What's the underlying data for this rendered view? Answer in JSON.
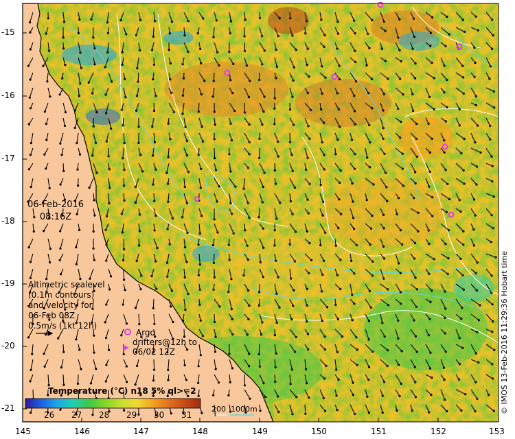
{
  "map": {
    "date": "06-Feb-2016",
    "time": "08:16Z",
    "credit": "© IMOS 13-Feb-2016 11:29:36 Hobart time",
    "y_ticks": [
      "-15",
      "-16",
      "-17",
      "-18",
      "-19",
      "-20",
      "-21"
    ],
    "x_ticks": [
      "145",
      "146",
      "147",
      "148",
      "149",
      "150",
      "151",
      "152",
      "153"
    ],
    "altimetry_legend": {
      "line1": "Altimetric sealevel",
      "line2": "(0.1m contours)",
      "line3": "and velocity for",
      "line4": "06-Feb 08Z",
      "line5": "0.5m/s (1kt 12h)"
    },
    "argo_legend": {
      "line1": "Argo",
      "line2": "drifters@12h to",
      "line3": "06/02 12Z"
    },
    "colorbar": {
      "title": "Temperature (°C) n18 5% ql>=2",
      "ticks": [
        "26",
        "27",
        "28",
        "29",
        "30",
        "31"
      ],
      "colors": [
        "#2b1b9a",
        "#1f5fe0",
        "#1ea6e6",
        "#20d0b4",
        "#3ec84a",
        "#7ed628",
        "#c8e030",
        "#f2d830",
        "#f2a020",
        "#e07020",
        "#c84a18",
        "#a02a10"
      ]
    },
    "depth_legend": {
      "label1": "200",
      "label2": "1000m"
    },
    "colors": {
      "land": "#f8c89c",
      "coast": "#000000",
      "contour_white": "#ffffff",
      "contour_cyan": "#5fd8d8",
      "argo": "#e040e0"
    }
  }
}
